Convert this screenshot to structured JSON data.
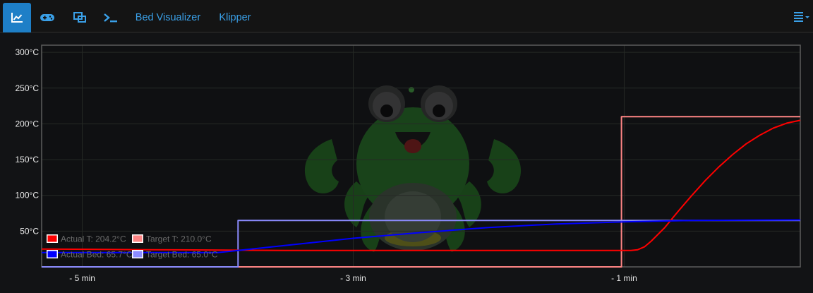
{
  "tabs": [
    {
      "id": "temperature",
      "icon": "chart-line-icon",
      "label": ""
    },
    {
      "id": "control",
      "icon": "gamepad-icon",
      "label": ""
    },
    {
      "id": "gcode-viewer",
      "icon": "object-group-icon",
      "label": ""
    },
    {
      "id": "terminal",
      "icon": "terminal-icon",
      "label": ""
    },
    {
      "id": "bed-visualizer",
      "icon": "",
      "label": "Bed Visualizer"
    },
    {
      "id": "klipper",
      "icon": "",
      "label": "Klipper"
    }
  ],
  "active_tab": "temperature",
  "menu_icon": "list-dropdown-icon",
  "colors": {
    "accent": "#1e7fc7",
    "link": "#3aa0e8",
    "actual_tool": "#ff0000",
    "target_tool": "#ff8585",
    "actual_bed": "#0000ff",
    "target_bed": "#8c8cff"
  },
  "watermark": "octoprint-logo",
  "chart_data": {
    "type": "line",
    "xlabel": "",
    "ylabel": "",
    "xlim": [
      -5.3,
      0.3
    ],
    "ylim": [
      0,
      310
    ],
    "x_unit": "min",
    "y_unit": "°C",
    "xticks": [
      {
        "value": -5,
        "label": "- 5 min"
      },
      {
        "value": -3,
        "label": "- 3 min"
      },
      {
        "value": -1,
        "label": "- 1 min"
      }
    ],
    "yticks": [
      {
        "value": 50,
        "label": "50°C"
      },
      {
        "value": 100,
        "label": "100°C"
      },
      {
        "value": 150,
        "label": "150°C"
      },
      {
        "value": 200,
        "label": "200°C"
      },
      {
        "value": 250,
        "label": "250°C"
      },
      {
        "value": 300,
        "label": "300°C"
      }
    ],
    "grid": true,
    "legend_position": "bottom-left",
    "series": [
      {
        "name": "Actual T: 204.2°C",
        "color": "#ff0000",
        "x": [
          -5.3,
          -4.5,
          -3.5,
          -2.5,
          -1.5,
          -1.0,
          -0.95,
          -0.9,
          -0.85,
          -0.8,
          -0.7,
          -0.6,
          -0.5,
          -0.4,
          -0.3,
          -0.2,
          -0.1,
          0.0,
          0.1,
          0.2,
          0.3
        ],
        "y": [
          25,
          24,
          23,
          23,
          23,
          23,
          23,
          24,
          28,
          36,
          55,
          78,
          100,
          121,
          140,
          157,
          172,
          184,
          194,
          201,
          205
        ]
      },
      {
        "name": "Target T: 210.0°C",
        "color": "#ff8585",
        "x": [
          -5.3,
          -1.02,
          -1.02,
          0.3
        ],
        "y": [
          0,
          0,
          210,
          210
        ]
      },
      {
        "name": "Actual Bed: 65.7°C",
        "color": "#0000ff",
        "x": [
          -5.3,
          -4.0,
          -3.9,
          -3.5,
          -3.0,
          -2.5,
          -2.0,
          -1.5,
          -1.0,
          -0.5,
          0.3
        ],
        "y": [
          20,
          20,
          22,
          30,
          40,
          48,
          55,
          60,
          63,
          65,
          65.7
        ]
      },
      {
        "name": "Target Bed: 65.0°C",
        "color": "#8c8cff",
        "x": [
          -5.3,
          -3.85,
          -3.85,
          0.3
        ],
        "y": [
          0,
          0,
          65,
          65
        ]
      }
    ]
  }
}
